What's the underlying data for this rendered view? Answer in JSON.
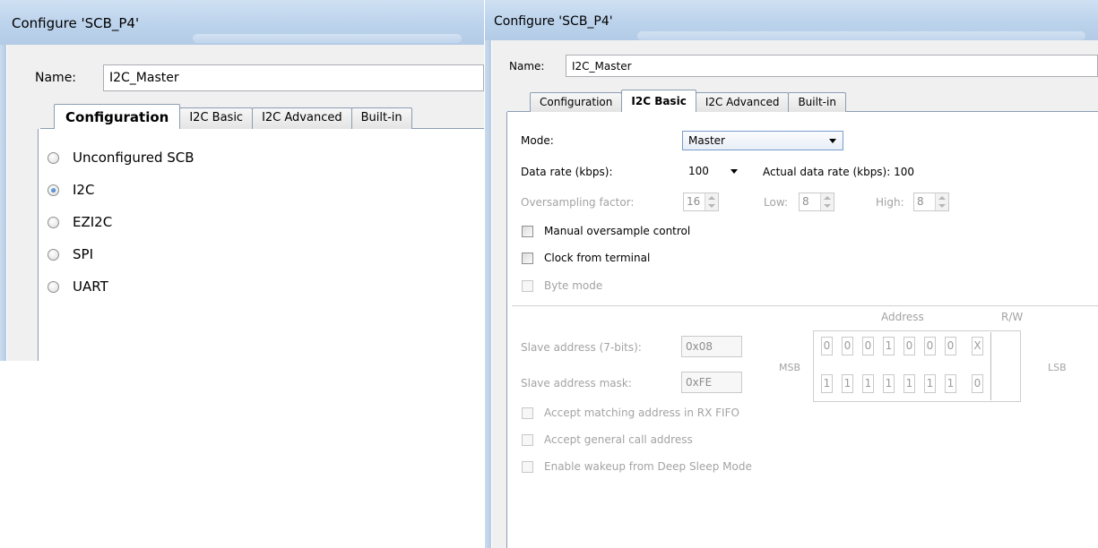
{
  "left_window": {
    "title": "Configure 'SCB_P4'",
    "name_label": "Name:",
    "name_value": "I2C_Master",
    "tabs": [
      "Configuration",
      "I2C Basic",
      "I2C Advanced",
      "Built-in"
    ],
    "active_tab": "Configuration",
    "radio_options": [
      {
        "label": "Unconfigured SCB",
        "checked": false
      },
      {
        "label": "I2C",
        "checked": true
      },
      {
        "label": "EZI2C",
        "checked": false
      },
      {
        "label": "SPI",
        "checked": false
      },
      {
        "label": "UART",
        "checked": false
      }
    ]
  },
  "right_window": {
    "title": "Configure 'SCB_P4'",
    "name_label": "Name:",
    "name_value": "I2C_Master",
    "tabs": [
      "Configuration",
      "I2C Basic",
      "I2C Advanced",
      "Built-in"
    ],
    "active_tab": "I2C Basic",
    "mode": {
      "label": "Mode:",
      "value": "Master"
    },
    "data_rate": {
      "label": "Data rate (kbps):",
      "value": "100",
      "actual_label": "Actual data rate (kbps): 100"
    },
    "oversampling": {
      "label": "Oversampling factor:",
      "value": "16",
      "low_label": "Low:",
      "low_value": "8",
      "high_label": "High:",
      "high_value": "8"
    },
    "checkboxes_top": [
      {
        "label": "Manual oversample control",
        "checked": false,
        "enabled": true
      },
      {
        "label": "Clock from terminal",
        "checked": false,
        "enabled": true
      },
      {
        "label": "Byte mode",
        "checked": false,
        "enabled": false
      }
    ],
    "address_header": "Address",
    "rw_header": "R/W",
    "msb_label": "MSB",
    "lsb_label": "LSB",
    "slave_address": {
      "label": "Slave address (7-bits):",
      "value": "0x08",
      "bits": [
        "0",
        "0",
        "0",
        "1",
        "0",
        "0",
        "0"
      ],
      "rw": "X"
    },
    "slave_mask": {
      "label": "Slave address mask:",
      "value": "0xFE",
      "bits": [
        "1",
        "1",
        "1",
        "1",
        "1",
        "1",
        "1"
      ],
      "rw": "0"
    },
    "checkboxes_bottom": [
      {
        "label": "Accept matching address in RX FIFO",
        "checked": false,
        "enabled": false
      },
      {
        "label": "Accept general call address",
        "checked": false,
        "enabled": false
      },
      {
        "label": "Enable wakeup from Deep Sleep Mode",
        "checked": false,
        "enabled": false
      }
    ],
    "colors": {
      "tab_border": "#8c9db3",
      "title_gradient": "#bcd3ec",
      "disabled_text": "#a3a3a3"
    }
  }
}
